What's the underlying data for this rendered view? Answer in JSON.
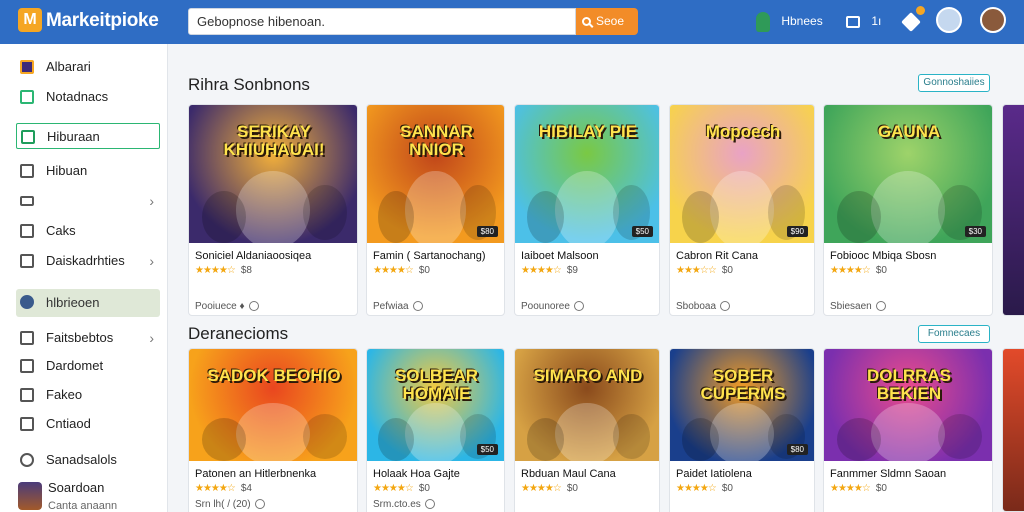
{
  "header": {
    "logo_letter": "M",
    "brand": "Markeitpioke",
    "search_value": "Gebopnose hibenoan.",
    "search_button": "Seoe",
    "user_label": "Hbnees",
    "cart_count": "1ı",
    "accent_color": "#2f6dc4",
    "button_color": "#f28c28"
  },
  "sidebar": {
    "items": [
      {
        "label": "Albarari",
        "icon": "app-icon"
      },
      {
        "label": "Notadnacs",
        "icon": "note-icon"
      },
      {
        "label": "Hiburaan",
        "icon": "grid-icon",
        "selected": true
      },
      {
        "label": "Hibuan",
        "icon": "doc-icon"
      },
      {
        "label": "",
        "icon": "mail-icon",
        "chevron": true
      },
      {
        "label": "Caks",
        "icon": "cube-icon"
      },
      {
        "label": "Daiskadrhties",
        "icon": "calendar-icon",
        "chevron": true
      },
      {
        "label": "hlbrieoen",
        "icon": "user-icon",
        "active": true
      },
      {
        "label": "Faitsbebtos",
        "icon": "list-icon",
        "chevron": true
      },
      {
        "label": "Dardomet",
        "icon": "box-icon"
      },
      {
        "label": "Fakeo",
        "icon": "file-icon"
      },
      {
        "label": "Cntiaod",
        "icon": "folder-icon"
      },
      {
        "label": "Sanadsalols",
        "icon": "settings-icon"
      }
    ],
    "user_name": "Soardoan",
    "user_sub": "Canta anaann"
  },
  "sections": [
    {
      "title": "Rihra Sonbnons",
      "link": "Gonnoshaiies",
      "cards": [
        {
          "thumb_text": "SERIKAY KHIUHAUAI!",
          "badge": "",
          "title": "Soniciel Aldaniaoosiqea",
          "extra": "dl",
          "rating": "★★★★☆",
          "price": "$8",
          "seller": "Pooiuece ♦",
          "bg1": "#3b2a6b",
          "bg2": "#f4b13a"
        },
        {
          "thumb_text": "SANNAR NNIOR",
          "badge": "$80",
          "title": "Famin ( Sartanochang)",
          "extra": "",
          "rating": "★★★★☆",
          "price": "$0",
          "seller": "Pefwiaa",
          "bg1": "#f39a1f",
          "bg2": "#c0451a"
        },
        {
          "thumb_text": "HIBILAY PIE",
          "badge": "$50",
          "title": "Iaiboet Malsoon",
          "extra": "",
          "rating": "★★★★☆",
          "price": "$9",
          "seller": "Poounoree",
          "bg1": "#4cc0e8",
          "bg2": "#7ac943"
        },
        {
          "thumb_text": "Mopoech",
          "badge": "$90",
          "title": "Cabron Rit Cana",
          "extra": "",
          "rating": "★★★☆☆",
          "price": "$0",
          "seller": "Sboboaa",
          "bg1": "#f7d34b",
          "bg2": "#e9a2c5"
        },
        {
          "thumb_text": "GAUNA",
          "badge": "$30",
          "title": "Fobiooc Mbiqa Sbosn",
          "extra": "",
          "rating": "★★★★☆",
          "price": "$0",
          "seller": "Sbiesaen",
          "bg1": "#3fa55a",
          "bg2": "#9ed36a"
        }
      ]
    },
    {
      "title": "Deranecioms",
      "link": "Fomnecaes",
      "cards": [
        {
          "thumb_text": "SADOK BEOHIO",
          "badge": "",
          "title": "Patonen an Hitlerbnenka",
          "extra": "",
          "rating": "★★★★☆",
          "price": "$4",
          "seller": "Srn lh( / (20)",
          "bg1": "#f7a21b",
          "bg2": "#e9461f"
        },
        {
          "thumb_text": "SOLBEAR HOMAIE",
          "badge": "$50",
          "title": "Holaak Hoa Gajte",
          "extra": "",
          "rating": "★★★★☆",
          "price": "$0",
          "seller": "Srm.cto.es",
          "bg1": "#2cb6e6",
          "bg2": "#f3c93f"
        },
        {
          "thumb_text": "SIMARO AND",
          "badge": "",
          "title": "Rbduan Maul Cana",
          "extra": "",
          "rating": "★★★★☆",
          "price": "$0",
          "seller": "",
          "bg1": "#d6a144",
          "bg2": "#8a4a1c"
        },
        {
          "thumb_text": "SOBER CUPERMS",
          "badge": "$80",
          "title": "Paidet Iatiolena",
          "extra": "",
          "rating": "★★★★☆",
          "price": "$0",
          "seller": "",
          "bg1": "#1a3f8c",
          "bg2": "#f29b24"
        },
        {
          "thumb_text": "DOLRRAS BEKIEN",
          "badge": "",
          "title": "Fanmmer Sldmn Saoan",
          "extra": "",
          "rating": "★★★★☆",
          "price": "$0",
          "seller": "",
          "bg1": "#7b2fae",
          "bg2": "#e94b8d"
        }
      ]
    }
  ]
}
